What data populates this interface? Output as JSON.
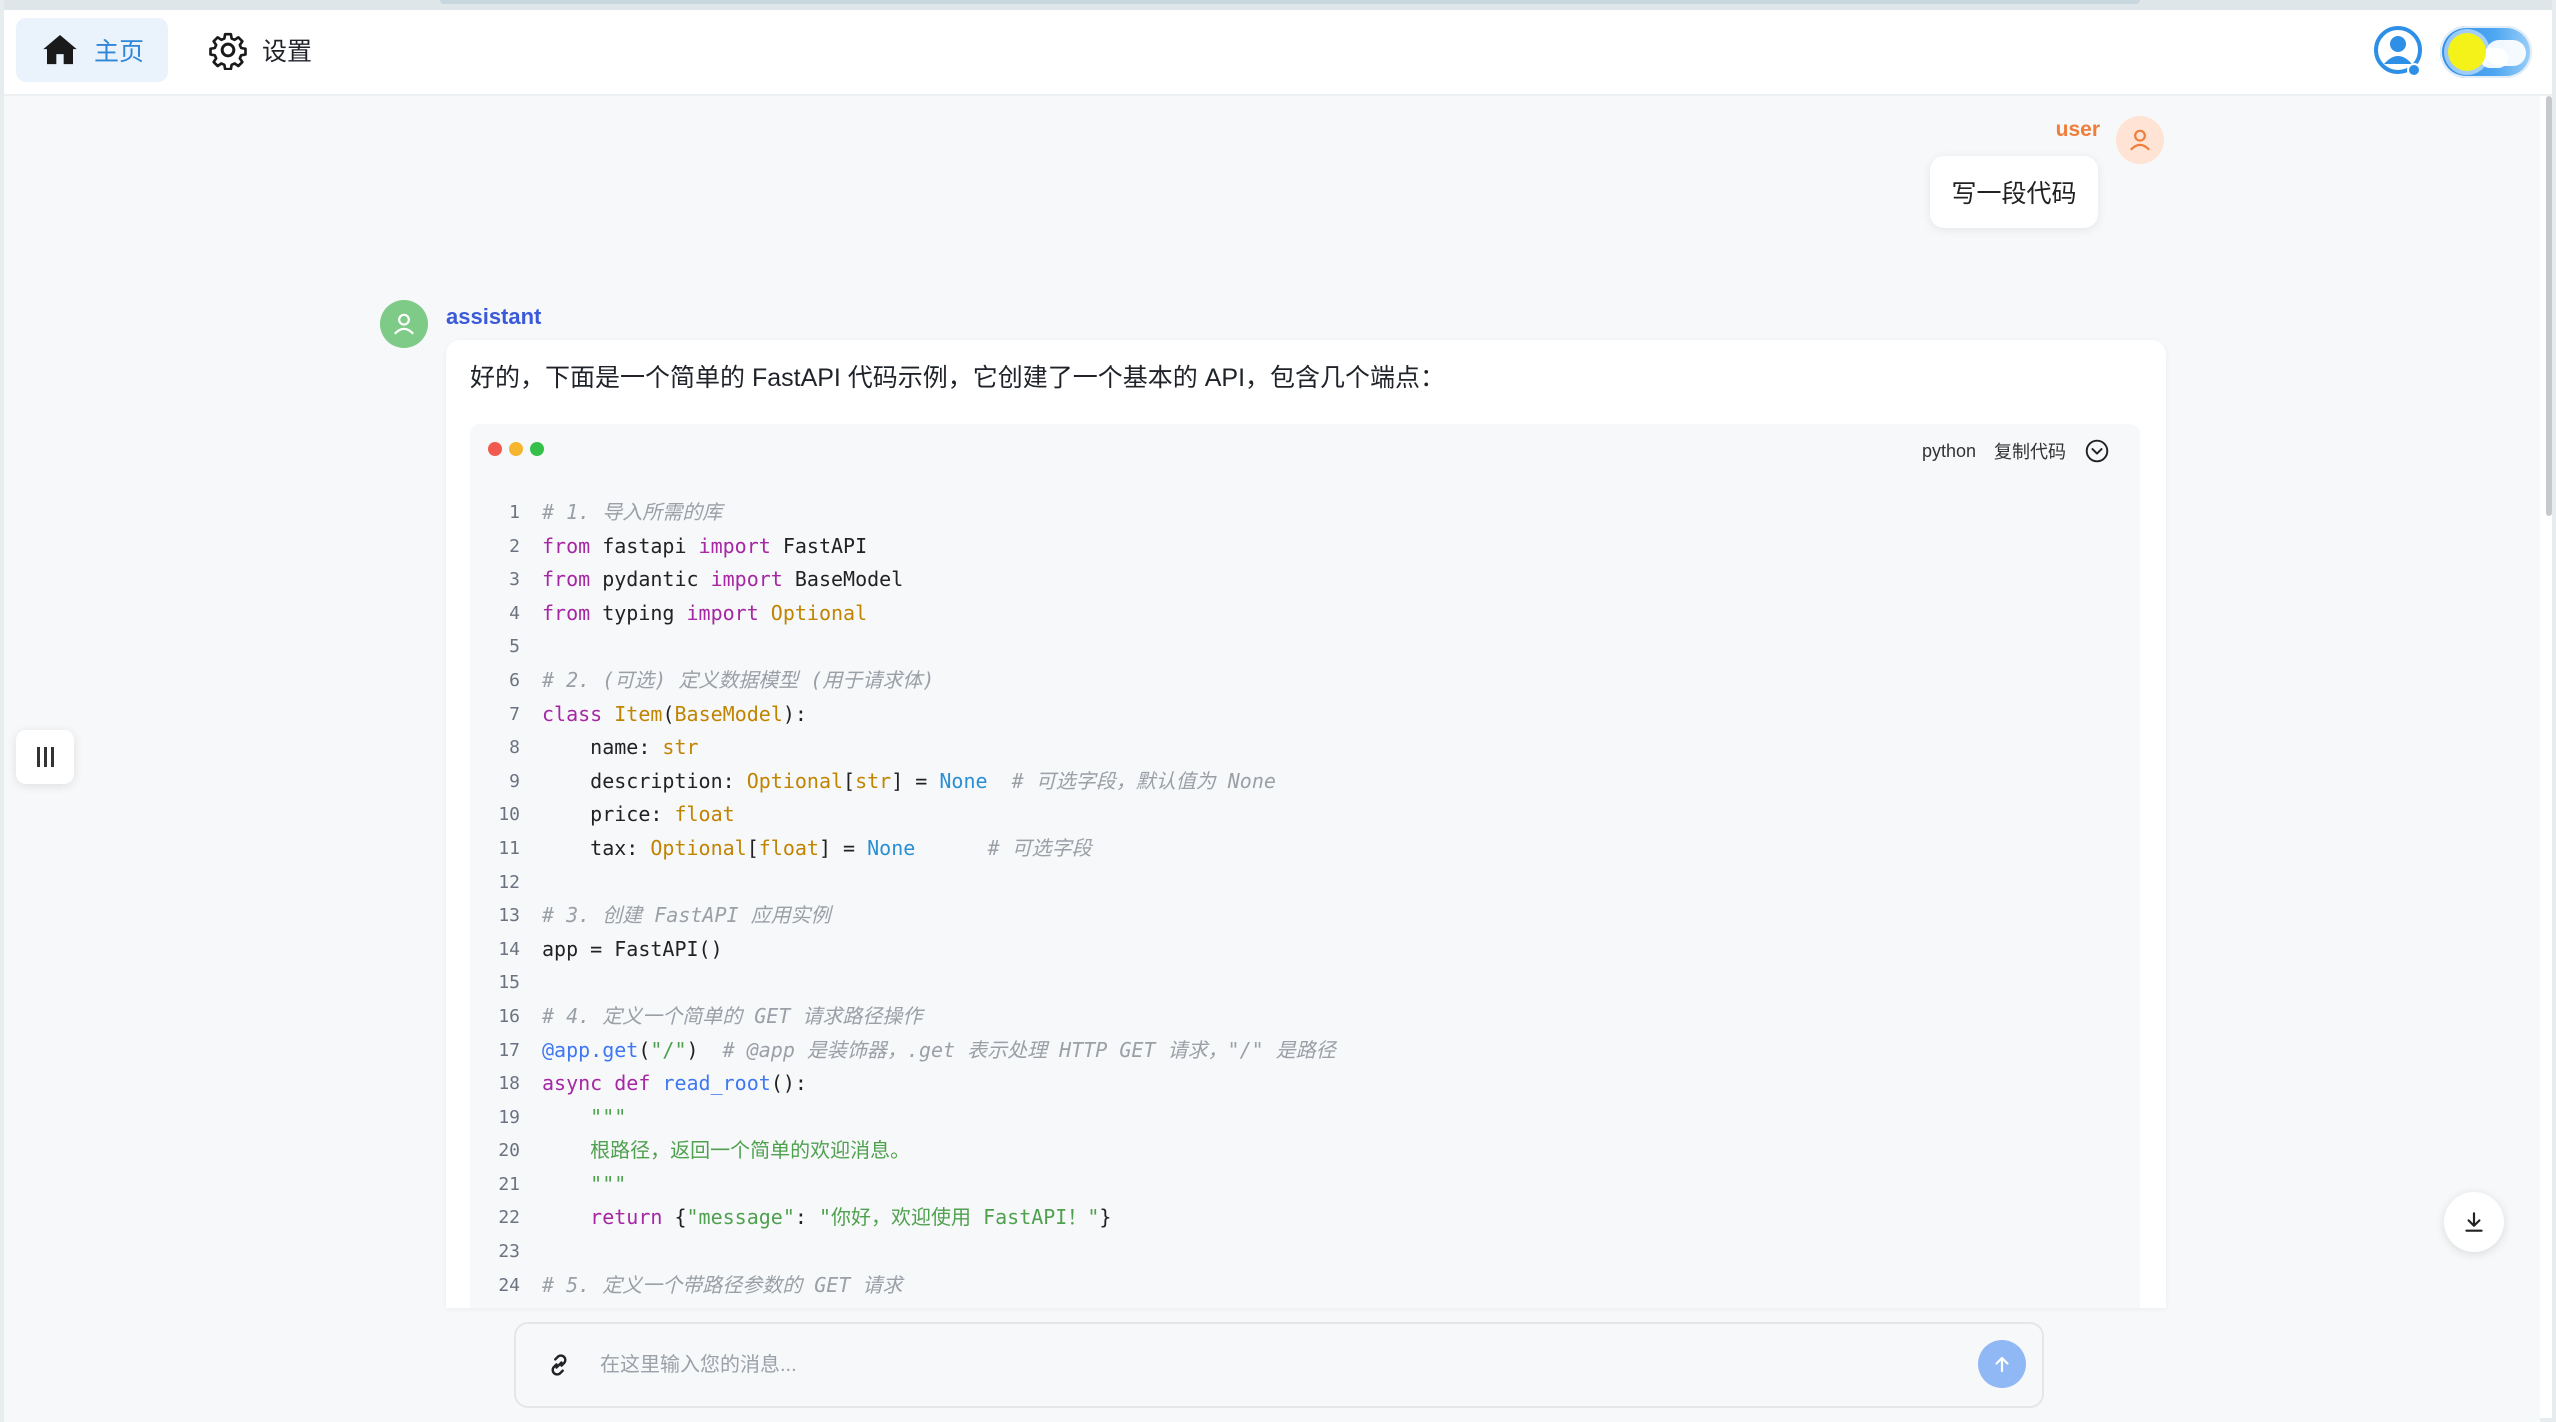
{
  "nav": {
    "home_label": "主页",
    "settings_label": "设置"
  },
  "colors": {
    "accent": "#2f86d6",
    "user_name": "#f07e3a",
    "assistant_name": "#3b5ad8",
    "send_button": "#8fb8f5"
  },
  "chat": {
    "user": {
      "name": "user",
      "message": "写一段代码"
    },
    "assistant": {
      "name": "assistant",
      "intro": "好的，下面是一个简单的 FastAPI 代码示例，它创建了一个基本的 API，包含几个端点："
    }
  },
  "code_block": {
    "language": "python",
    "copy_label": "复制代码",
    "lines": [
      {
        "n": "1",
        "tokens": [
          {
            "c": "comment",
            "t": "# 1. 导入所需的库"
          }
        ]
      },
      {
        "n": "2",
        "tokens": [
          {
            "c": "kw",
            "t": "from"
          },
          {
            "c": "",
            "t": " fastapi "
          },
          {
            "c": "kw",
            "t": "import"
          },
          {
            "c": "",
            "t": " FastAPI"
          }
        ]
      },
      {
        "n": "3",
        "tokens": [
          {
            "c": "kw",
            "t": "from"
          },
          {
            "c": "",
            "t": " pydantic "
          },
          {
            "c": "kw",
            "t": "import"
          },
          {
            "c": "",
            "t": " BaseModel"
          }
        ]
      },
      {
        "n": "4",
        "tokens": [
          {
            "c": "kw",
            "t": "from"
          },
          {
            "c": "",
            "t": " typing "
          },
          {
            "c": "kw",
            "t": "import"
          },
          {
            "c": "",
            "t": " "
          },
          {
            "c": "cls",
            "t": "Optional"
          }
        ]
      },
      {
        "n": "5",
        "tokens": []
      },
      {
        "n": "6",
        "tokens": [
          {
            "c": "comment",
            "t": "# 2. (可选) 定义数据模型 (用于请求体)"
          }
        ]
      },
      {
        "n": "7",
        "tokens": [
          {
            "c": "kw",
            "t": "class"
          },
          {
            "c": "",
            "t": " "
          },
          {
            "c": "cls",
            "t": "Item"
          },
          {
            "c": "",
            "t": "("
          },
          {
            "c": "cls",
            "t": "BaseModel"
          },
          {
            "c": "",
            "t": "):"
          }
        ]
      },
      {
        "n": "8",
        "tokens": [
          {
            "c": "",
            "t": "    name: "
          },
          {
            "c": "cls",
            "t": "str"
          }
        ]
      },
      {
        "n": "9",
        "tokens": [
          {
            "c": "",
            "t": "    description: "
          },
          {
            "c": "cls",
            "t": "Optional"
          },
          {
            "c": "",
            "t": "["
          },
          {
            "c": "cls",
            "t": "str"
          },
          {
            "c": "",
            "t": "] = "
          },
          {
            "c": "num",
            "t": "None"
          },
          {
            "c": "",
            "t": "  "
          },
          {
            "c": "comment",
            "t": "# 可选字段，默认值为 None"
          }
        ]
      },
      {
        "n": "10",
        "tokens": [
          {
            "c": "",
            "t": "    price: "
          },
          {
            "c": "cls",
            "t": "float"
          }
        ]
      },
      {
        "n": "11",
        "tokens": [
          {
            "c": "",
            "t": "    tax: "
          },
          {
            "c": "cls",
            "t": "Optional"
          },
          {
            "c": "",
            "t": "["
          },
          {
            "c": "cls",
            "t": "float"
          },
          {
            "c": "",
            "t": "] = "
          },
          {
            "c": "num",
            "t": "None"
          },
          {
            "c": "",
            "t": "      "
          },
          {
            "c": "comment",
            "t": "# 可选字段"
          }
        ]
      },
      {
        "n": "12",
        "tokens": []
      },
      {
        "n": "13",
        "tokens": [
          {
            "c": "comment",
            "t": "# 3. 创建 FastAPI 应用实例"
          }
        ]
      },
      {
        "n": "14",
        "tokens": [
          {
            "c": "",
            "t": "app = FastAPI()"
          }
        ]
      },
      {
        "n": "15",
        "tokens": []
      },
      {
        "n": "16",
        "tokens": [
          {
            "c": "comment",
            "t": "# 4. 定义一个简单的 GET 请求路径操作"
          }
        ]
      },
      {
        "n": "17",
        "tokens": [
          {
            "c": "dec",
            "t": "@app.get"
          },
          {
            "c": "",
            "t": "("
          },
          {
            "c": "str",
            "t": "\"/\""
          },
          {
            "c": "",
            "t": ")  "
          },
          {
            "c": "comment",
            "t": "# @app 是装饰器，.get 表示处理 HTTP GET 请求，\"/\" 是路径"
          }
        ]
      },
      {
        "n": "18",
        "tokens": [
          {
            "c": "kw",
            "t": "async"
          },
          {
            "c": "",
            "t": " "
          },
          {
            "c": "kw",
            "t": "def"
          },
          {
            "c": "",
            "t": " "
          },
          {
            "c": "fn",
            "t": "read_root"
          },
          {
            "c": "",
            "t": "():"
          }
        ]
      },
      {
        "n": "19",
        "tokens": [
          {
            "c": "str",
            "t": "    \"\"\""
          }
        ]
      },
      {
        "n": "20",
        "tokens": [
          {
            "c": "str",
            "t": "    根路径，返回一个简单的欢迎消息。"
          }
        ]
      },
      {
        "n": "21",
        "tokens": [
          {
            "c": "str",
            "t": "    \"\"\""
          }
        ]
      },
      {
        "n": "22",
        "tokens": [
          {
            "c": "",
            "t": "    "
          },
          {
            "c": "kw",
            "t": "return"
          },
          {
            "c": "",
            "t": " {"
          },
          {
            "c": "str",
            "t": "\"message\""
          },
          {
            "c": "",
            "t": ": "
          },
          {
            "c": "str",
            "t": "\"你好，欢迎使用 FastAPI！\""
          },
          {
            "c": "",
            "t": "}"
          }
        ]
      },
      {
        "n": "23",
        "tokens": []
      },
      {
        "n": "24",
        "tokens": [
          {
            "c": "comment",
            "t": "# 5. 定义一个带路径参数的 GET 请求"
          }
        ]
      }
    ]
  },
  "composer": {
    "placeholder": "在这里输入您的消息..."
  },
  "icons": {
    "home": "home-icon",
    "settings": "gear-icon",
    "profile": "user-circle-icon",
    "theme": "theme-toggle",
    "sidebar": "sidebar-toggle-icon",
    "download": "download-icon",
    "attach": "link-icon",
    "send": "arrow-up-icon",
    "collapse": "chevron-down-circle-icon"
  }
}
